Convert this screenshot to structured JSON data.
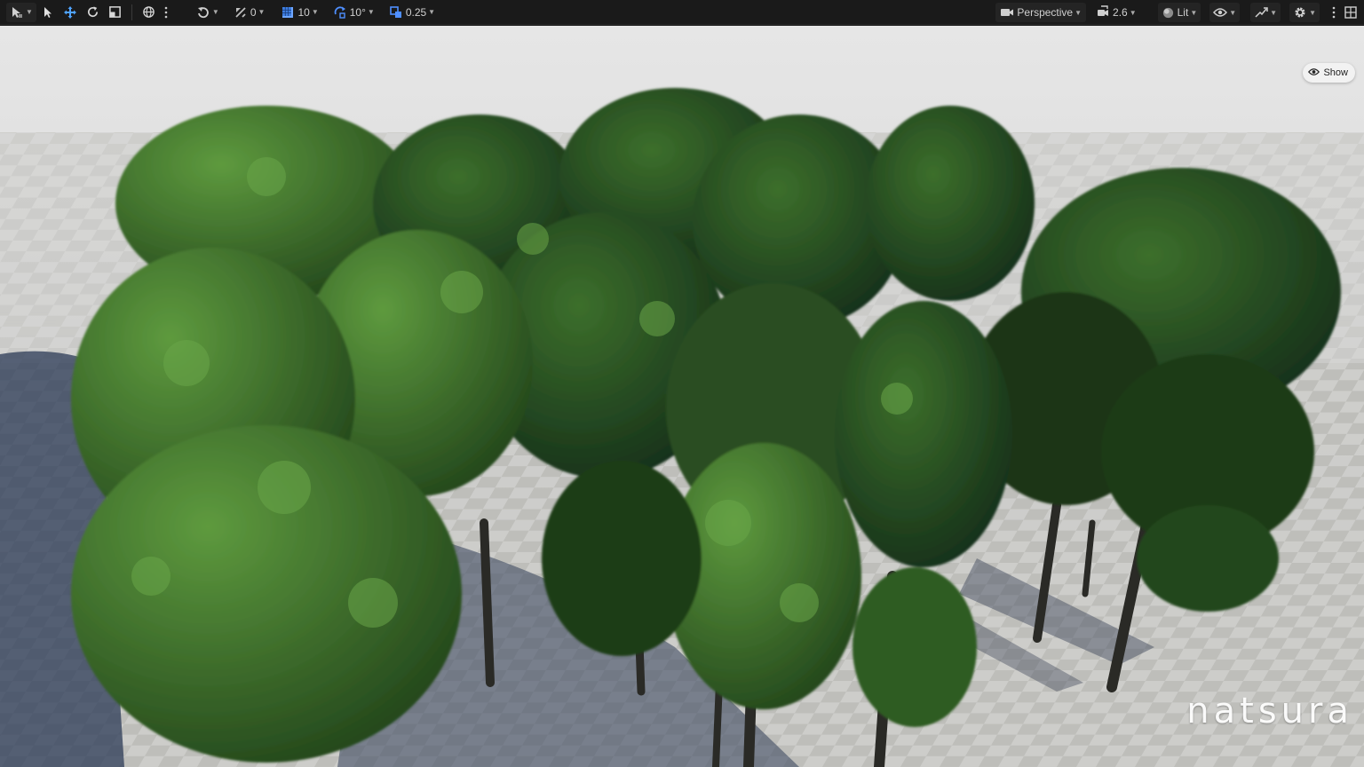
{
  "toolbar": {
    "translate_snap_value": "0",
    "grid_snap_value": "10",
    "rotation_snap_value": "10°",
    "scale_snap_value": "0.25",
    "view_mode_label": "Perspective",
    "camera_speed_value": "2.6",
    "lighting_mode_label": "Lit",
    "icons": [
      "select-mode-icon",
      "pointer-icon",
      "move-icon",
      "rotate-icon",
      "scale-icon",
      "world-local-icon",
      "more-icon",
      "surface-snap-icon",
      "translate-snap-icon",
      "grid-snap-icon",
      "rotation-snap-icon",
      "scale-snap-icon",
      "camera-icon",
      "camera-speed-icon",
      "lit-sphere-icon",
      "show-eye-icon",
      "realtime-icon",
      "settings-icon",
      "kebab-icon",
      "layout-icon"
    ]
  },
  "viewport": {
    "show_button_label": "Show",
    "watermark_text": "natsura",
    "colors": {
      "sky": "#d6d7d8",
      "ground_light": "#cfcfcc",
      "ground_dark": "#bdbdb9",
      "shadow": "#2b3a56",
      "foliage_dark": "#1d3a17",
      "foliage_mid": "#2f5c22",
      "foliage_light": "#4f8a35",
      "trunk": "#2a2a26"
    }
  }
}
